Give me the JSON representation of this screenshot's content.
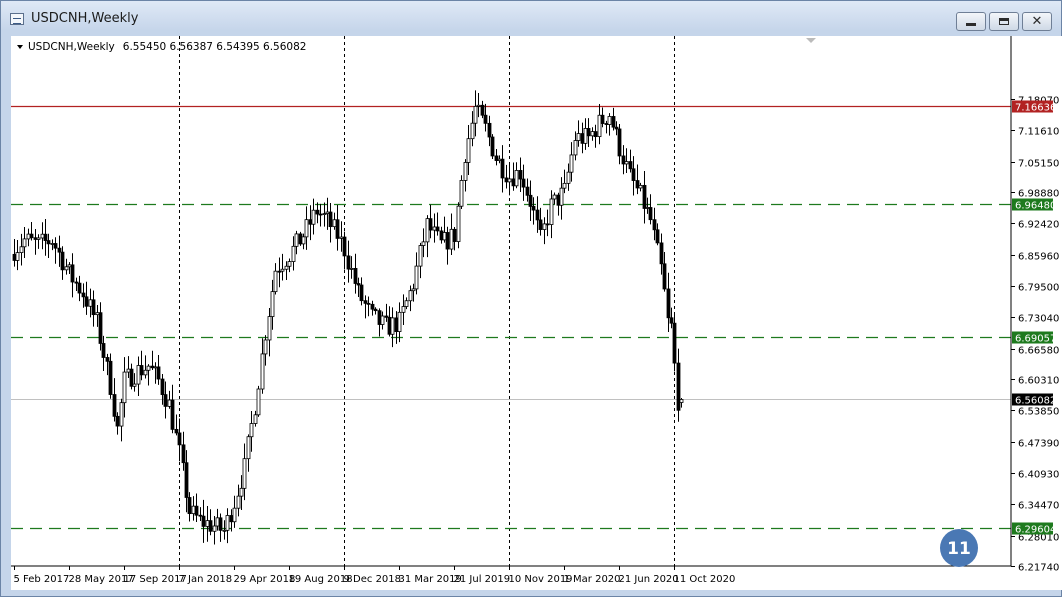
{
  "window": {
    "title": "USDCNH,Weekly"
  },
  "chart_header": {
    "symbol": "USDCNH,Weekly",
    "ohlc": "6.55450 6.56387 6.54395 6.56082"
  },
  "badge": {
    "text": "11",
    "color": "#4a78b4"
  },
  "colors": {
    "candle": "#000000",
    "resistance": "#b22222",
    "support": "#1e7a1e",
    "current_price": "#000000"
  },
  "chart_data": {
    "type": "candlestick",
    "symbol": "USDCNH",
    "timeframe": "Weekly",
    "last_ohlc": {
      "open": 6.5545,
      "high": 6.56387,
      "low": 6.54395,
      "close": 6.56082
    },
    "ylim": [
      6.2174,
      7.2402
    ],
    "y_ticks": [
      "7.18070",
      "7.11610",
      "7.05150",
      "6.98880",
      "6.92420",
      "6.85960",
      "6.79500",
      "6.73040",
      "6.66580",
      "6.60310",
      "6.53850",
      "6.47390",
      "6.40930",
      "6.34470",
      "6.28010",
      "6.21740"
    ],
    "x_ticks": [
      "5 Feb 2017",
      "28 May 2017",
      "17 Sep 2017",
      "7 Jan 2018",
      "29 Apr 2018",
      "19 Aug 2018",
      "9 Dec 2018",
      "31 Mar 2019",
      "21 Jul 2019",
      "10 Nov 2019",
      "1 Mar 2020",
      "21 Jun 2020",
      "11 Oct 2020"
    ],
    "vertical_separators": [
      "7 Jan 2018",
      "9 Dec 2018",
      "10 Nov 2019",
      "11 Oct 2020"
    ],
    "horizontal_levels": [
      {
        "label": "7.16636",
        "value": 7.16636,
        "kind": "resistance"
      },
      {
        "label": "6.96480",
        "value": 6.9648,
        "kind": "support"
      },
      {
        "label": "6.69057",
        "value": 6.69057,
        "kind": "support"
      },
      {
        "label": "6.56082",
        "value": 6.56082,
        "kind": "current"
      },
      {
        "label": "6.29604",
        "value": 6.29604,
        "kind": "support"
      }
    ],
    "close_path": [
      [
        "5 Feb 2017",
        6.87
      ],
      [
        "26 Feb 2017",
        6.89
      ],
      [
        "26 Mar 2017",
        6.88
      ],
      [
        "23 Apr 2017",
        6.89
      ],
      [
        "28 May 2017",
        6.82
      ],
      [
        "25 Jun 2017",
        6.78
      ],
      [
        "23 Jul 2017",
        6.72
      ],
      [
        "20 Aug 2017",
        6.59
      ],
      [
        "3 Sep 2017",
        6.5
      ],
      [
        "17 Sep 2017",
        6.6
      ],
      [
        "15 Oct 2017",
        6.62
      ],
      [
        "5 Nov 2017",
        6.63
      ],
      [
        "26 Nov 2017",
        6.6
      ],
      [
        "17 Dec 2017",
        6.55
      ],
      [
        "7 Jan 2018",
        6.45
      ],
      [
        "28 Jan 2018",
        6.33
      ],
      [
        "18 Feb 2018",
        6.31
      ],
      [
        "18 Mar 2018",
        6.3
      ],
      [
        "8 Apr 2018",
        6.29
      ],
      [
        "29 Apr 2018",
        6.35
      ],
      [
        "20 May 2018",
        6.42
      ],
      [
        "10 Jun 2018",
        6.55
      ],
      [
        "1 Jul 2018",
        6.7
      ],
      [
        "22 Jul 2018",
        6.83
      ],
      [
        "19 Aug 2018",
        6.86
      ],
      [
        "16 Sep 2018",
        6.9
      ],
      [
        "14 Oct 2018",
        6.95
      ],
      [
        "4 Nov 2018",
        6.93
      ],
      [
        "25 Nov 2018",
        6.9
      ],
      [
        "9 Dec 2018",
        6.87
      ],
      [
        "6 Jan 2019",
        6.78
      ],
      [
        "3 Feb 2019",
        6.73
      ],
      [
        "3 Mar 2019",
        6.71
      ],
      [
        "31 Mar 2019",
        6.72
      ],
      [
        "28 Apr 2019",
        6.8
      ],
      [
        "26 May 2019",
        6.92
      ],
      [
        "23 Jun 2019",
        6.88
      ],
      [
        "21 Jul 2019",
        6.9
      ],
      [
        "11 Aug 2019",
        7.07
      ],
      [
        "1 Sep 2019",
        7.16
      ],
      [
        "22 Sep 2019",
        7.12
      ],
      [
        "13 Oct 2019",
        7.06
      ],
      [
        "10 Nov 2019",
        7.02
      ],
      [
        "1 Dec 2019",
        7.03
      ],
      [
        "22 Dec 2019",
        6.97
      ],
      [
        "12 Jan 2020",
        6.89
      ],
      [
        "2 Feb 2020",
        6.96
      ],
      [
        "1 Mar 2020",
        6.99
      ],
      [
        "22 Mar 2020",
        7.1
      ],
      [
        "19 Apr 2020",
        7.1
      ],
      [
        "10 May 2020",
        7.13
      ],
      [
        "31 May 2020",
        7.15
      ],
      [
        "21 Jun 2020",
        7.08
      ],
      [
        "12 Jul 2020",
        7.02
      ],
      [
        "2 Aug 2020",
        6.98
      ],
      [
        "23 Aug 2020",
        6.93
      ],
      [
        "13 Sep 2020",
        6.83
      ],
      [
        "20 Sep 2020",
        6.78
      ],
      [
        "27 Sep 2020",
        6.72
      ],
      [
        "4 Oct 2020",
        6.71
      ],
      [
        "11 Oct 2020",
        6.63
      ],
      [
        "18 Oct 2020",
        6.56
      ],
      [
        "25 Oct 2020",
        6.56
      ]
    ]
  }
}
